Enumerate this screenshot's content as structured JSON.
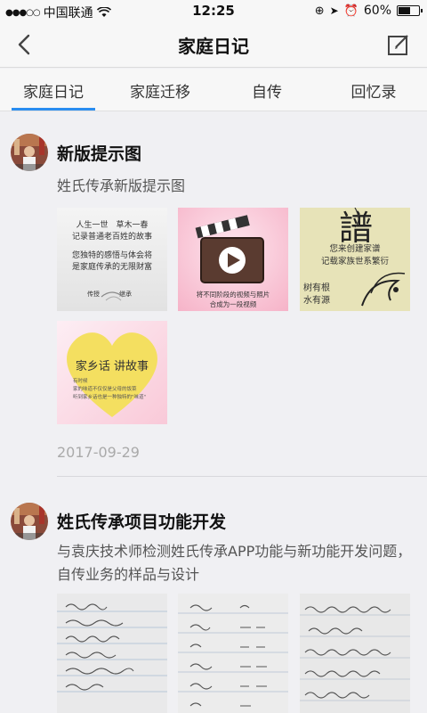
{
  "status_bar": {
    "carrier": "中国联通",
    "time": "12:25",
    "battery_percent": "60%",
    "battery_level": 0.6
  },
  "nav": {
    "title": "家庭日记",
    "back_icon": "chevron-left-icon",
    "edit_icon": "compose-icon"
  },
  "tabs": [
    {
      "label": "家庭日记",
      "active": true
    },
    {
      "label": "家庭迁移",
      "active": false
    },
    {
      "label": "自传",
      "active": false
    },
    {
      "label": "回忆录",
      "active": false
    }
  ],
  "accent_color": "#2a8df0",
  "posts": [
    {
      "title": "新版提示图",
      "text": "姓氏传承新版提示图",
      "date": "2017-09-29",
      "images": [
        {
          "lines": [
            "人生一世　草木一春",
            "记录普通老百姓的故事",
            "您独特的感悟与体会将",
            "是家庭传承的无限财富"
          ],
          "footer": [
            "传授",
            "继承"
          ]
        },
        {
          "lines": [
            "将不同阶段的视频与照片",
            "合成为一段视频"
          ]
        },
        {
          "big": "譜",
          "lines": [
            "您来创建家谱",
            "记载家族世系繁衍"
          ],
          "footer": [
            "树有根",
            "水有源"
          ]
        },
        {
          "title": "家乡话 讲故事",
          "lines": [
            "有时候",
            "家的味道不仅仅是父母的饭菜",
            "听到家乡话也是一种独特的\"味道\""
          ]
        }
      ]
    },
    {
      "title": "姓氏传承项目功能开发",
      "text": "与袁庆技术师检测姓氏传承APP功能与新功能开发问题，自传业务的样品与设计"
    }
  ]
}
